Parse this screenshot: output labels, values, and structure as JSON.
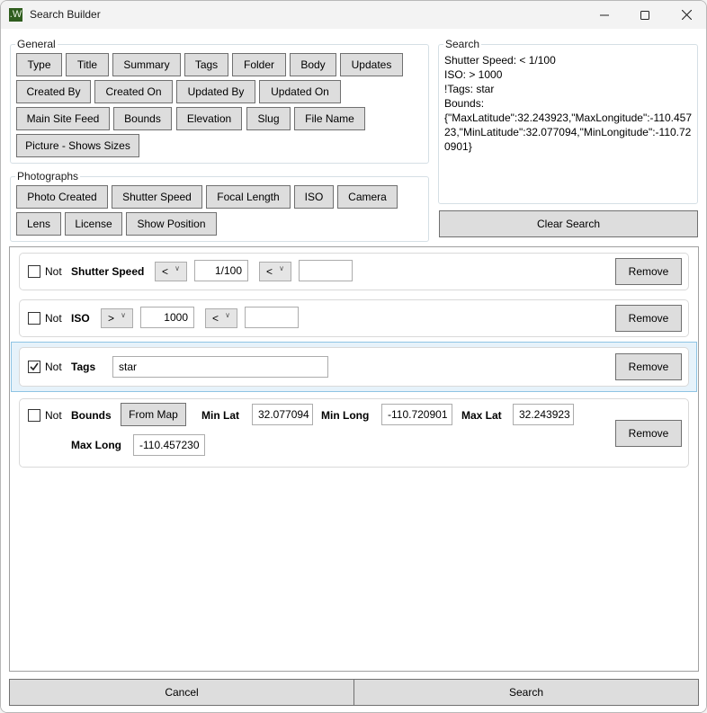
{
  "window": {
    "title": "Search Builder",
    "app_icon_letter": ".W",
    "controls": {
      "minimize": "minimize-icon",
      "maximize": "maximize-icon",
      "close": "close-icon"
    }
  },
  "general": {
    "label": "General",
    "buttons": [
      "Type",
      "Title",
      "Summary",
      "Tags",
      "Folder",
      "Body",
      "Updates",
      "Created By",
      "Created On",
      "Updated By",
      "Updated On",
      "Main Site Feed",
      "Bounds",
      "Elevation",
      "Slug",
      "File Name",
      "Picture - Shows Sizes"
    ]
  },
  "photographs": {
    "label": "Photographs",
    "buttons": [
      "Photo Created",
      "Shutter Speed",
      "Focal Length",
      "ISO",
      "Camera",
      "Lens",
      "License",
      "Show Position"
    ]
  },
  "search": {
    "label": "Search",
    "text": "Shutter Speed: < 1/100\nISO: > 1000\n!Tags: star\nBounds:\n{\"MaxLatitude\":32.243923,\"MaxLongitude\":-110.45723,\"MinLatitude\":32.077094,\"MinLongitude\":-110.720901}",
    "clear_label": "Clear Search"
  },
  "filters": [
    {
      "not_label": "Not",
      "not_checked": false,
      "field": "Shutter Speed",
      "op1": "<",
      "value1": "1/100",
      "op2": "<",
      "value2": "",
      "remove_label": "Remove"
    },
    {
      "not_label": "Not",
      "not_checked": false,
      "field": "ISO",
      "op1": ">",
      "value1": "1000",
      "op2": "<",
      "value2": "",
      "remove_label": "Remove"
    },
    {
      "not_label": "Not",
      "not_checked": true,
      "field": "Tags",
      "value": "star",
      "selected": true,
      "remove_label": "Remove"
    },
    {
      "not_label": "Not",
      "not_checked": false,
      "field": "Bounds",
      "from_map_label": "From Map",
      "min_lat_label": "Min Lat",
      "min_lat": "32.077094",
      "min_long_label": "Min Long",
      "min_long": "-110.720901",
      "max_lat_label": "Max Lat",
      "max_lat": "32.243923",
      "max_long_label": "Max Long",
      "max_long": "-110.457230",
      "remove_label": "Remove"
    }
  ],
  "footer": {
    "cancel_label": "Cancel",
    "search_label": "Search"
  }
}
